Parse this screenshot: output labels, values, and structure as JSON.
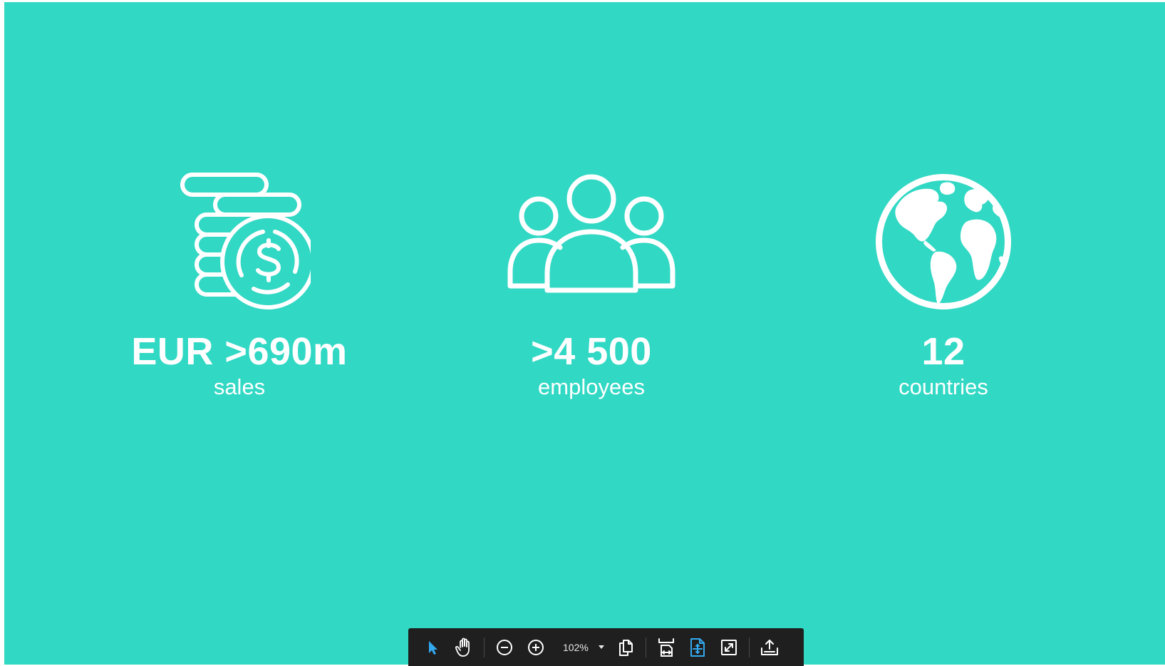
{
  "colors": {
    "slide_background": "#31d8c4",
    "slide_foreground": "#ffffff",
    "toolbar_background": "#1f1f1f",
    "toolbar_icon": "#ffffff",
    "toolbar_active_icon": "#33a9f0"
  },
  "stats": [
    {
      "icon": "coins-dollar-icon",
      "value": "EUR >690m",
      "label": "sales"
    },
    {
      "icon": "people-group-icon",
      "value": ">4 500",
      "label": "employees"
    },
    {
      "icon": "globe-icon",
      "value": "12",
      "label": "countries"
    }
  ],
  "toolbar": {
    "zoom": "102%",
    "buttons": [
      {
        "icon": "select-arrow-icon",
        "active": true
      },
      {
        "icon": "hand-pan-icon",
        "active": false
      },
      {
        "icon": "zoom-out-icon",
        "active": false
      },
      {
        "icon": "zoom-in-icon",
        "active": false
      },
      {
        "icon": "pages-icon",
        "active": false
      },
      {
        "icon": "fit-width-icon",
        "active": false
      },
      {
        "icon": "fit-page-icon",
        "active": true
      },
      {
        "icon": "fullscreen-icon",
        "active": false
      },
      {
        "icon": "share-export-icon",
        "active": false
      }
    ]
  }
}
